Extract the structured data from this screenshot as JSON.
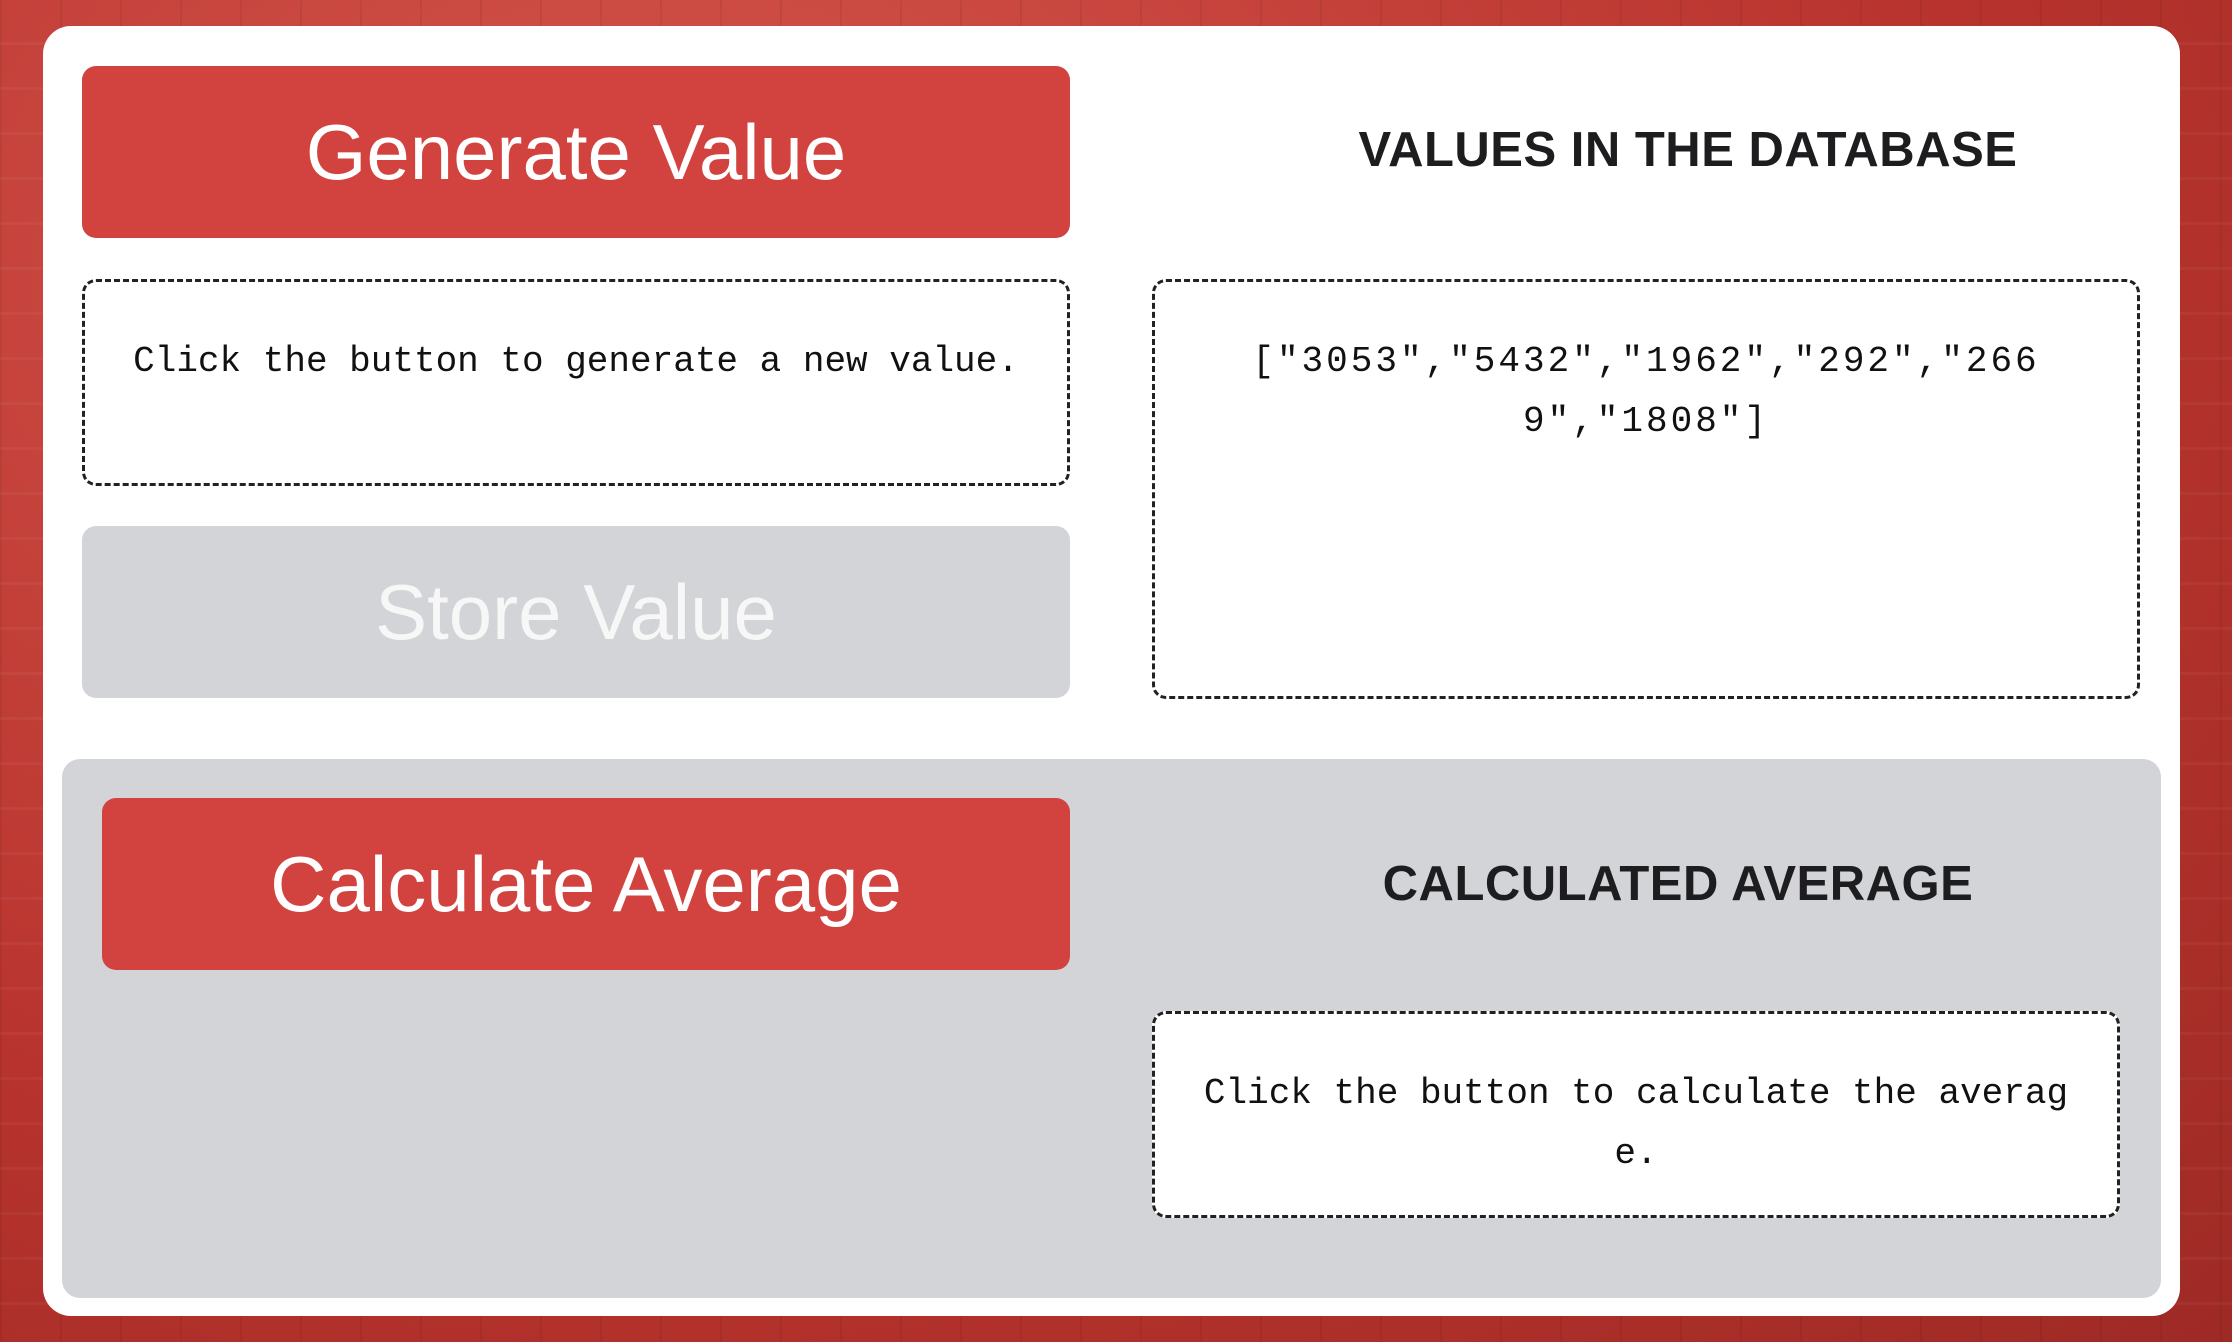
{
  "generate": {
    "button_label": "Generate Value",
    "message": "Click the button to generate a new value."
  },
  "store": {
    "button_label": "Store Value"
  },
  "database": {
    "heading": "VALUES IN THE DATABASE",
    "values_text": "[\"3053\",\"5432\",\"1962\",\"292\",\"2669\",\"1808\"]"
  },
  "average": {
    "button_label": "Calculate Average",
    "heading": "CALCULATED AVERAGE",
    "message": "Click the button to calculate the average."
  },
  "colors": {
    "accent": "#d2433f",
    "disabled": "#d3d4d7",
    "panel": "#d3d4d7",
    "background": "#c8403a"
  }
}
